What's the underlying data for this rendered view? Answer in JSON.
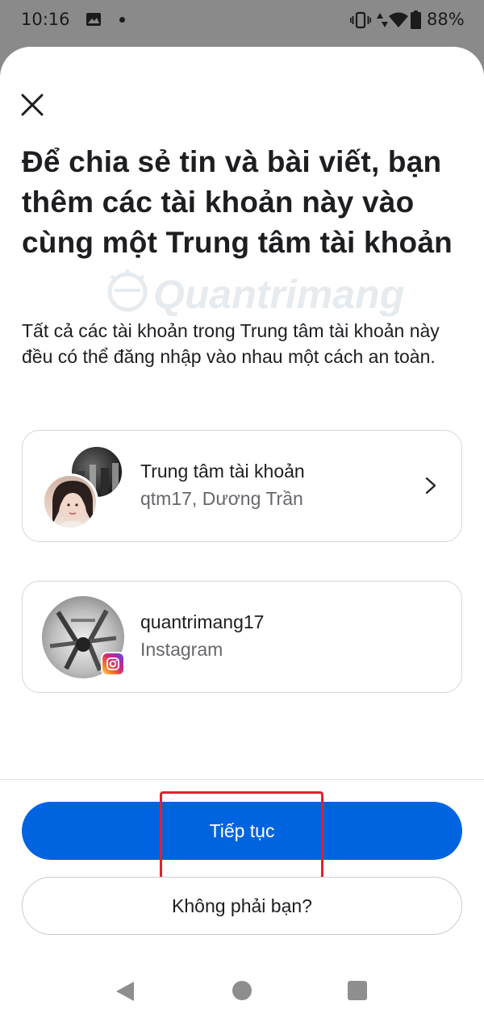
{
  "status_bar": {
    "time": "10:16",
    "battery": "88%",
    "icons": [
      "gallery-icon",
      "dot-icon",
      "vibrate-icon",
      "data-icon",
      "wifi-icon",
      "battery-icon"
    ]
  },
  "sheet": {
    "close_icon": "close-icon",
    "heading": "Để chia sẻ tin và bài viết, bạn thêm các tài khoản này vào cùng một Trung tâm tài khoản",
    "description": "Tất cả các tài khoản trong Trung tâm tài khoản này đều có thể đăng nhập vào nhau một cách an toàn.",
    "watermark": "Quantrimang"
  },
  "accounts_center": {
    "title": "Trung tâm tài khoản",
    "subtitle": "qtm17, Dương Trần",
    "chevron_icon": "chevron-right-icon"
  },
  "instagram_account": {
    "username": "quantrimang17",
    "platform": "Instagram",
    "badge_icon": "instagram-icon"
  },
  "actions": {
    "continue_label": "Tiếp tục",
    "not_you_label": "Không phải bạn?"
  },
  "colors": {
    "primary": "#0064e0",
    "highlight": "#e0212e",
    "text": "#1c1e21",
    "secondary_text": "#65676b"
  },
  "nav_bar": {
    "icons": [
      "back-icon",
      "home-icon",
      "recents-icon"
    ]
  }
}
